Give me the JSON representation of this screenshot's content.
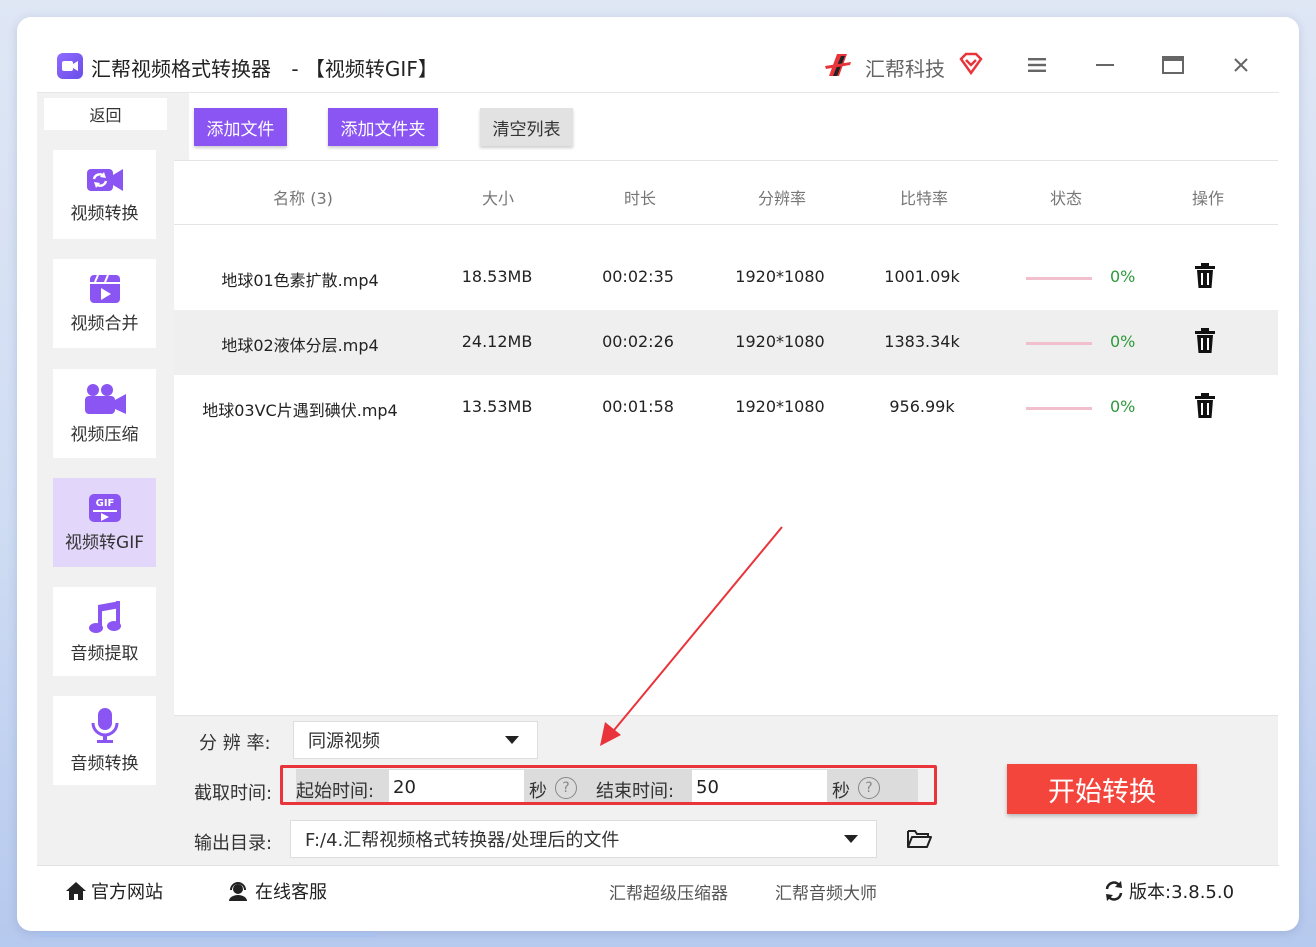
{
  "app": {
    "title": "汇帮视频格式转换器",
    "subtitle": " - 【视频转GIF】",
    "brand": "汇帮科技"
  },
  "sidebar": {
    "back_label": "返回",
    "items": [
      {
        "label": "视频转换",
        "icon": "video-convert-icon"
      },
      {
        "label": "视频合并",
        "icon": "video-merge-icon"
      },
      {
        "label": "视频压缩",
        "icon": "video-compress-icon"
      },
      {
        "label": "视频转GIF",
        "icon": "gif-icon",
        "active": true
      },
      {
        "label": "音频提取",
        "icon": "music-note-icon"
      },
      {
        "label": "音频转换",
        "icon": "microphone-icon"
      }
    ]
  },
  "toolbar": {
    "add_file": "添加文件",
    "add_folder": "添加文件夹",
    "clear_list": "清空列表"
  },
  "table": {
    "headers": [
      "名称 (3)",
      "大小",
      "时长",
      "分辨率",
      "比特率",
      "状态",
      "操作"
    ],
    "rows": [
      {
        "name": "地球01色素扩散.mp4",
        "size": "18.53MB",
        "duration": "00:02:35",
        "resolution": "1920*1080",
        "bitrate": "1001.09k",
        "progress": 0,
        "status": "0%"
      },
      {
        "name": "地球02液体分层.mp4",
        "size": "24.12MB",
        "duration": "00:02:26",
        "resolution": "1920*1080",
        "bitrate": "1383.34k",
        "progress": 0,
        "status": "0%"
      },
      {
        "name": "地球03VC片遇到碘伏.mp4",
        "size": "13.53MB",
        "duration": "00:01:58",
        "resolution": "1920*1080",
        "bitrate": "956.99k",
        "progress": 0,
        "status": "0%"
      }
    ]
  },
  "settings": {
    "resolution_label": "分 辨 率:",
    "resolution_value": "同源视频",
    "clip_label": "截取时间:",
    "start_label": "起始时间:",
    "start_value": "20",
    "end_label": "结束时间:",
    "end_value": "50",
    "seconds_unit": "秒",
    "help_glyph": "?",
    "output_label": "输出目录:",
    "output_value": "F:/4.汇帮视频格式转换器/处理后的文件",
    "start_button": "开始转换"
  },
  "footer": {
    "website": "官方网站",
    "support": "在线客服",
    "link1": "汇帮超级压缩器",
    "link2": "汇帮音频大师",
    "version": "版本:3.8.5.0"
  },
  "colors": {
    "accent": "#8a55f2",
    "active_nav": "#e2d7fb",
    "start_button": "#f4453d",
    "progress_status": "#2e9a3a",
    "annotation": "#e8343a"
  }
}
